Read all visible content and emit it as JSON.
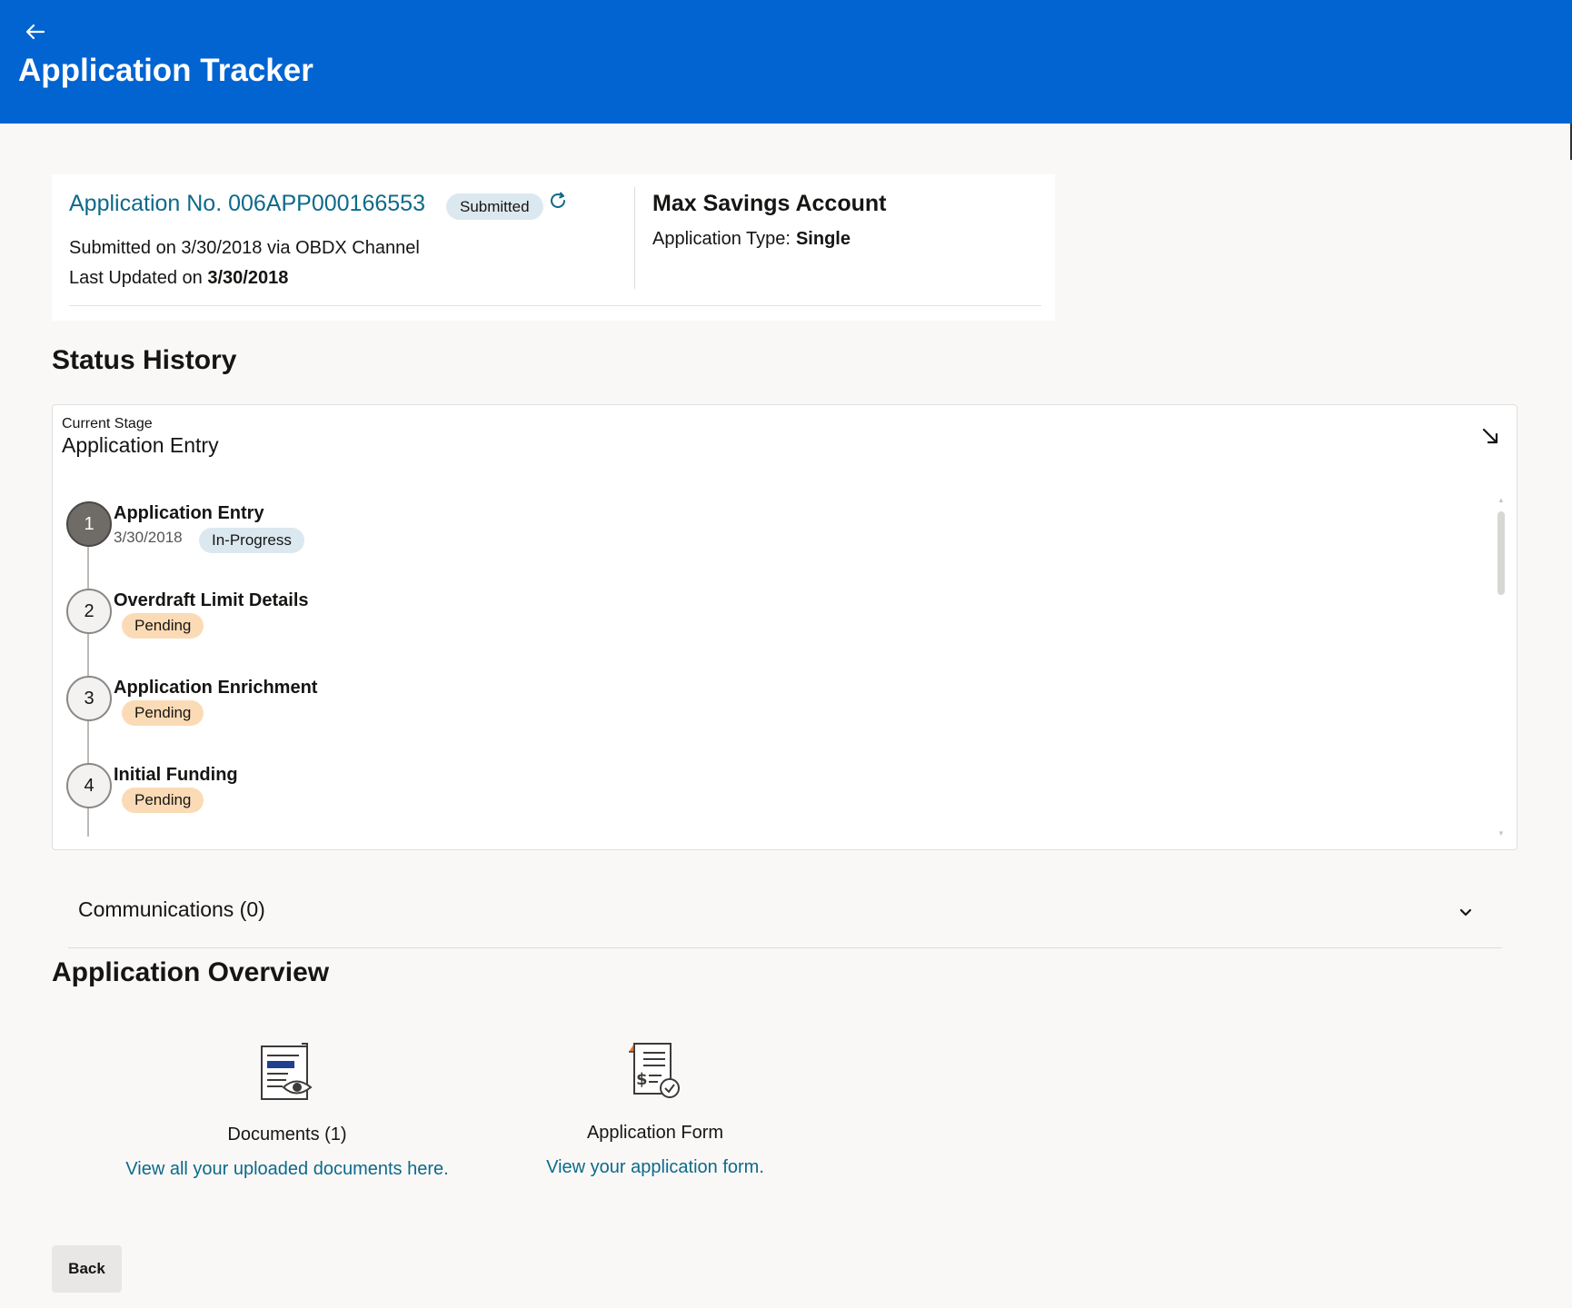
{
  "header": {
    "back_icon": "arrow-left-icon",
    "title": "Application Tracker"
  },
  "summary": {
    "app_no_label": "Application No. 006APP000166553",
    "status": "Submitted",
    "refresh_icon": "refresh-icon",
    "submitted_on": "Submitted on 3/30/2018 via OBDX Channel",
    "last_updated_prefix": "Last Updated on ",
    "last_updated_date": "3/30/2018",
    "product_name": "Max Savings Account",
    "app_type_label": "Application Type:",
    "app_type_value": "Single"
  },
  "status_history": {
    "title": "Status History",
    "current_stage_label": "Current Stage",
    "current_stage_value": "Application Entry",
    "collapse_icon": "collapse-arrow-icon",
    "steps": [
      {
        "number": "1",
        "title": "Application Entry",
        "date": "3/30/2018",
        "status": "In-Progress"
      },
      {
        "number": "2",
        "title": "Overdraft Limit Details",
        "status": "Pending"
      },
      {
        "number": "3",
        "title": "Application Enrichment",
        "status": "Pending"
      },
      {
        "number": "4",
        "title": "Initial Funding",
        "status": "Pending"
      }
    ]
  },
  "communications": {
    "label": "Communications (0)",
    "chevron_icon": "chevron-down-icon"
  },
  "overview": {
    "title": "Application Overview",
    "documents": {
      "icon": "document-view-icon",
      "label": "Documents (1)",
      "link": "View all your uploaded documents here."
    },
    "form": {
      "icon": "application-form-icon",
      "label": "Application Form",
      "link": "View your application form."
    }
  },
  "footer": {
    "back_label": "Back"
  },
  "colors": {
    "header_bg": "#0164d1",
    "link": "#0d6a8a",
    "pill_blue": "#dce8ef",
    "pill_orange": "#fbdbb6"
  }
}
